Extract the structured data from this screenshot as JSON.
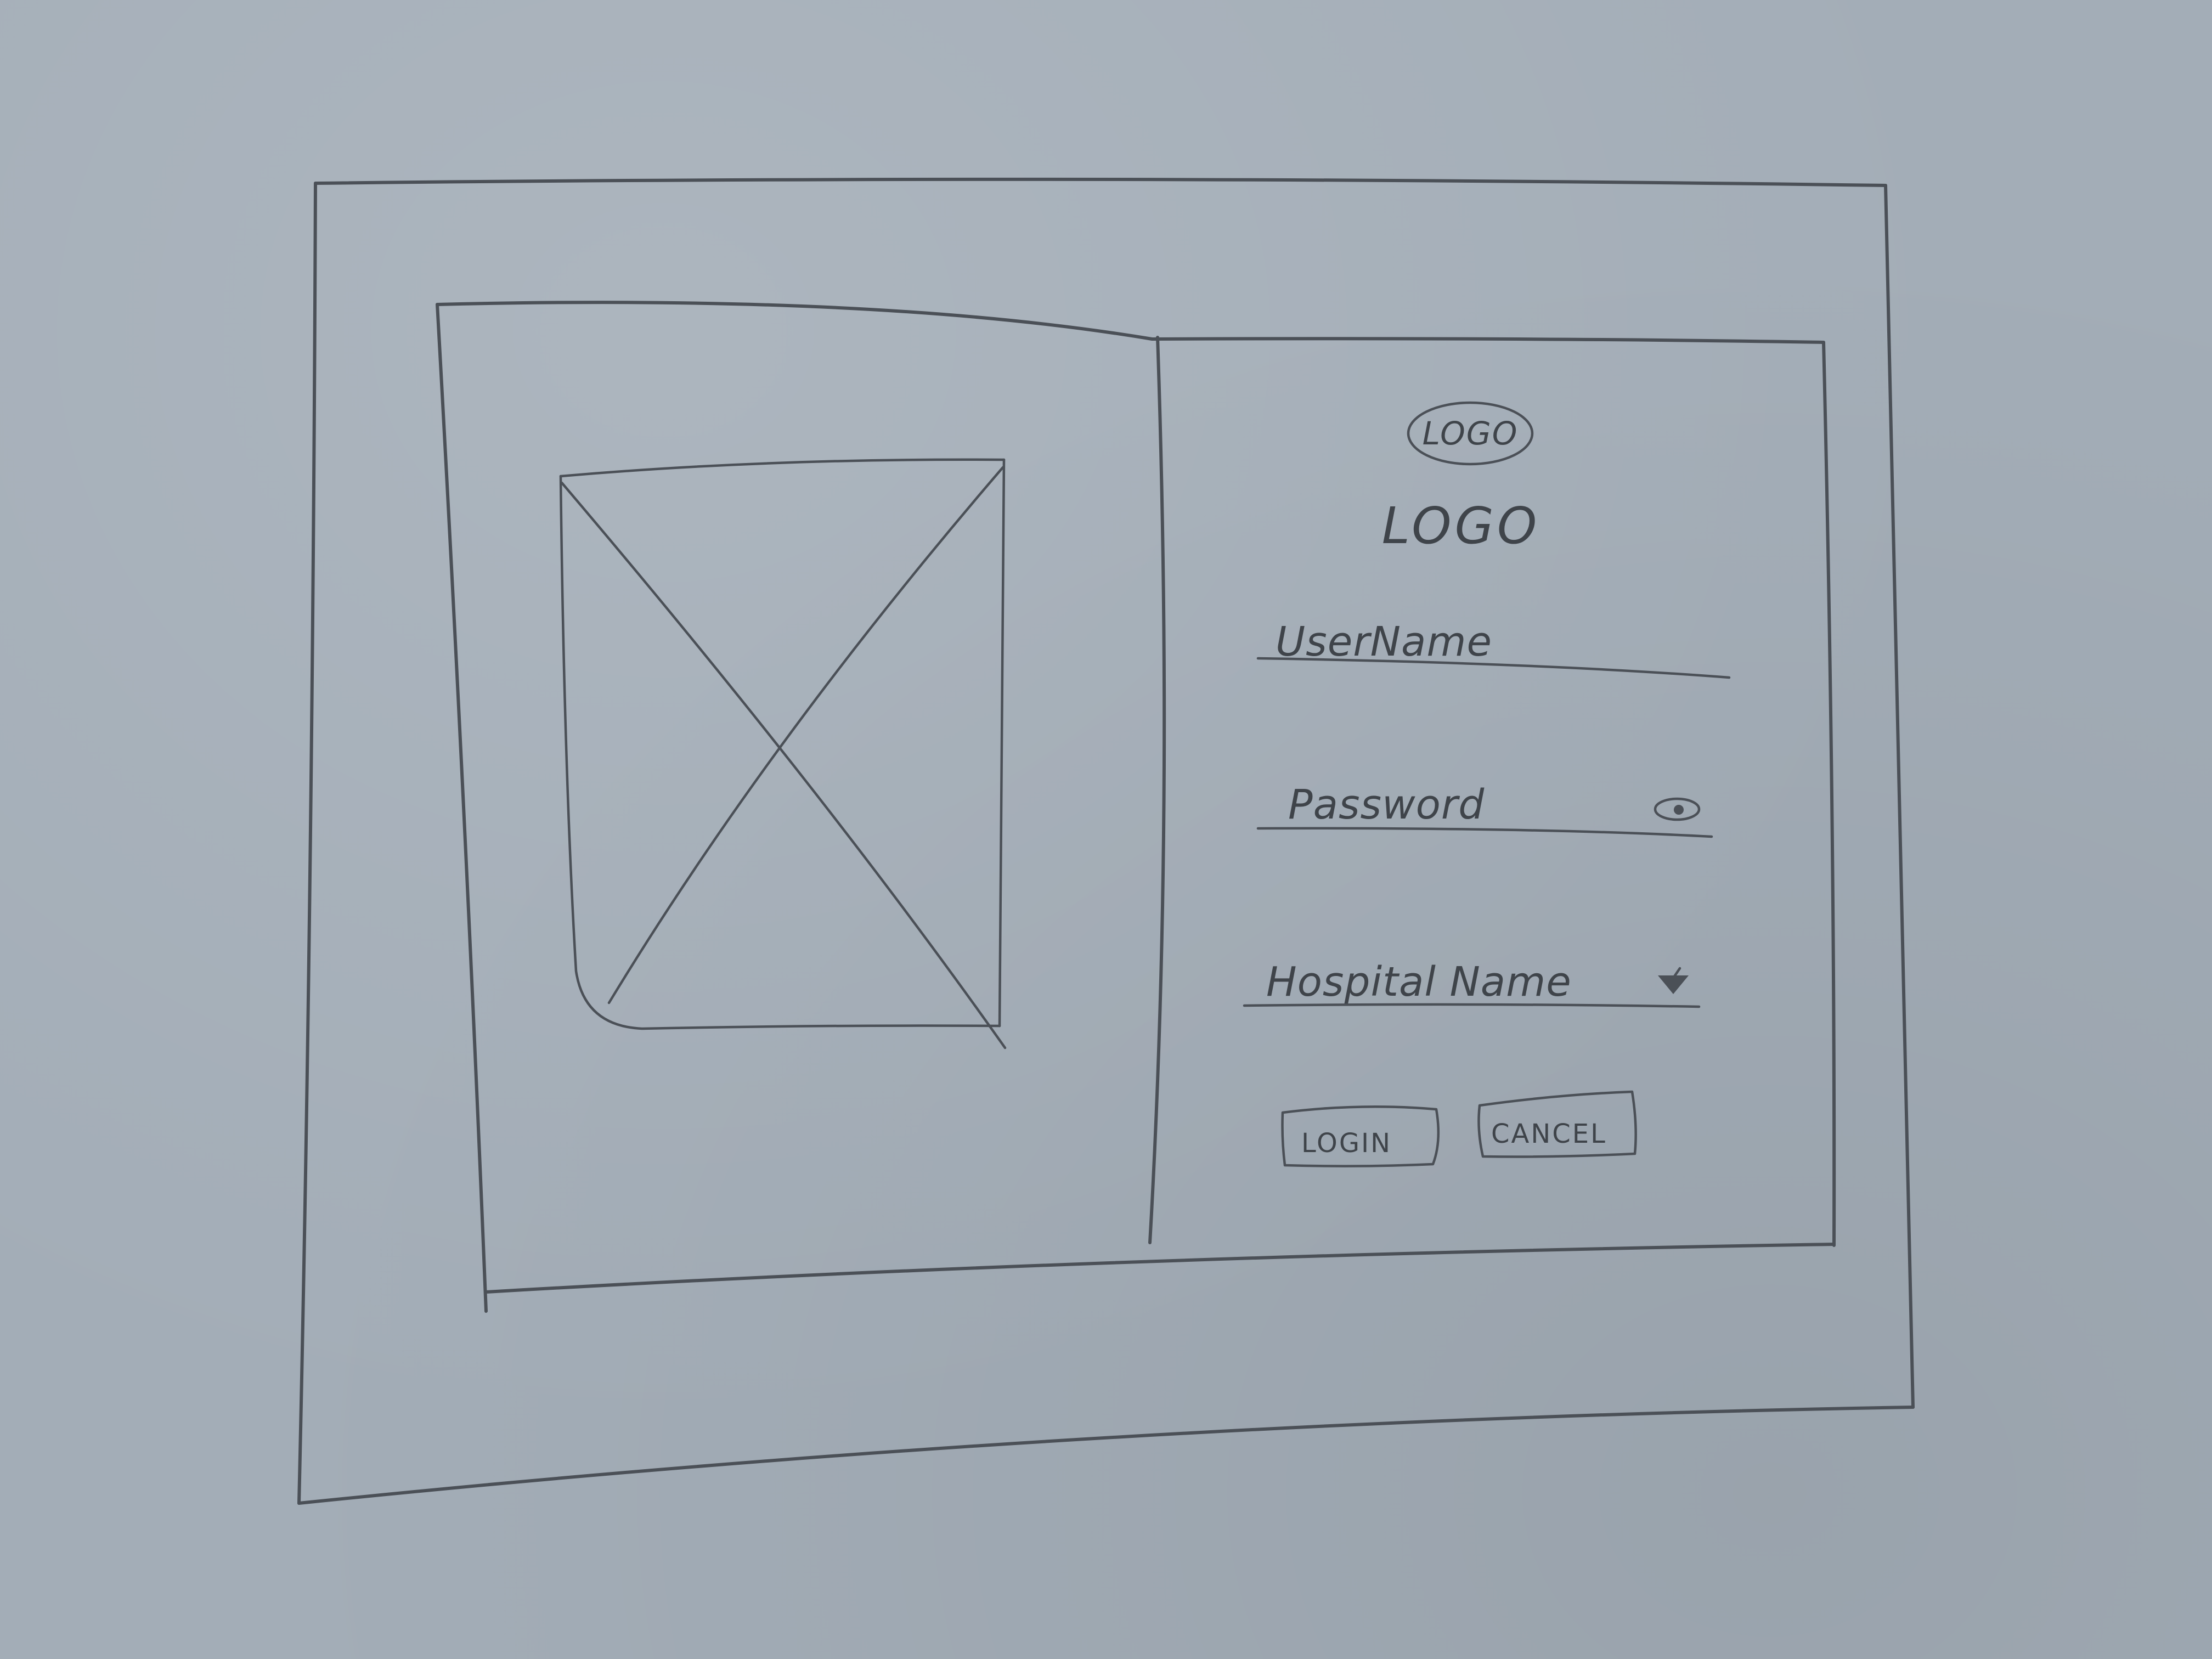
{
  "login_panel": {
    "logo_badge_text": "LOGO",
    "logo_text": "LOGO",
    "username_field": {
      "placeholder": "UserName",
      "value": ""
    },
    "password_field": {
      "placeholder": "Password",
      "value": "",
      "toggle_icon": "eye-icon"
    },
    "hospital_field": {
      "placeholder": "Hospital Name",
      "selected_value": "",
      "dropdown_icon": "dropdown-arrow-icon"
    },
    "buttons": {
      "login_label": "LOGIN",
      "cancel_label": "CANCEL"
    }
  },
  "image_panel": {
    "image": "image-placeholder"
  },
  "colors": {
    "paper": "#a3adb7",
    "pencil": "#4b5057"
  }
}
